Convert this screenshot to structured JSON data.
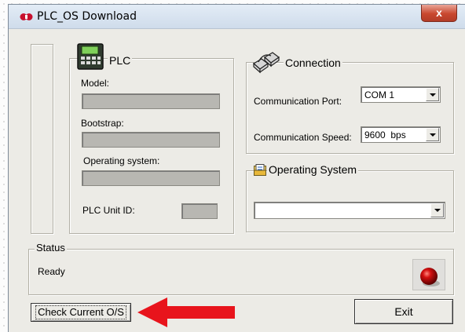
{
  "window": {
    "title": "PLC_OS Download",
    "close_label": "x"
  },
  "plc": {
    "group_title": "PLC",
    "model_label": "Model:",
    "bootstrap_label": "Bootstrap:",
    "os_label": "Operating system:",
    "unit_id_label": "PLC Unit ID:"
  },
  "connection": {
    "group_title": "Connection",
    "port_label": "Communication Port:",
    "port_value": "COM 1",
    "speed_label": "Communication Speed:",
    "speed_value": "9600  bps"
  },
  "operating_system": {
    "group_title": "Operating System",
    "selected_value": ""
  },
  "status": {
    "group_title": "Status",
    "text": "Ready"
  },
  "buttons": {
    "check_label": "Check Current O/S",
    "exit_label": "Exit"
  },
  "colors": {
    "led": "#c00000",
    "arrow": "#e8141c",
    "close": "#c9482f"
  }
}
